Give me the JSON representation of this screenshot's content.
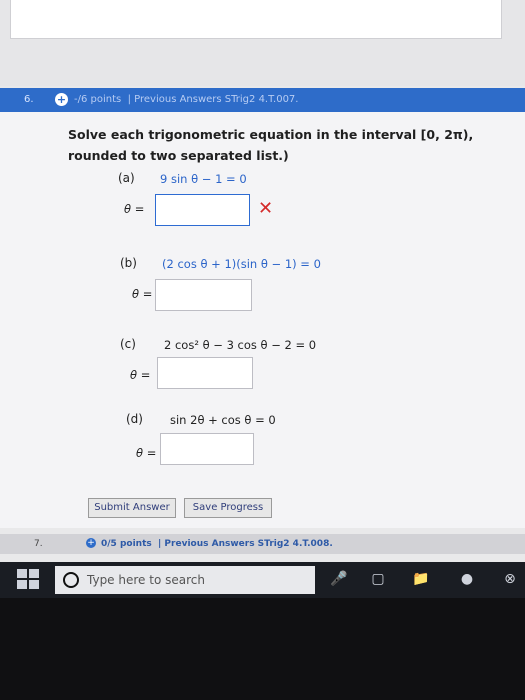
{
  "question6": {
    "number": "6.",
    "points": "-/6 points",
    "source": "| Previous Answers   STrig2 4.T.007."
  },
  "prompt": "Solve each trigonometric equation in the interval [0, 2π), rounded to two separated list.)",
  "parts": [
    {
      "label": "(a)",
      "equation": "9 sin θ − 1 = 0",
      "answer": "",
      "status": "incorrect"
    },
    {
      "label": "(b)",
      "equation": "(2 cos θ + 1)(sin θ − 1) = 0",
      "answer": ""
    },
    {
      "label": "(c)",
      "equation": "2 cos² θ − 3 cos θ − 2 = 0",
      "answer": ""
    },
    {
      "label": "(d)",
      "equation": "sin 2θ + cos θ = 0",
      "answer": ""
    }
  ],
  "theta_label": "θ =",
  "buttons": {
    "submit": "Submit Answer",
    "save": "Save Progress"
  },
  "question7": {
    "number": "7.",
    "points": "0/5 points",
    "source": "|  Previous Answers   STrig2 4.T.008."
  },
  "taskbar": {
    "search_placeholder": "Type here to search"
  },
  "colors": {
    "header_blue": "#2e6cc9",
    "error_red": "#d42a2a"
  },
  "icons": [
    "windows-start-icon",
    "search-ring-icon",
    "microphone-icon",
    "task-view-icon",
    "file-explorer-icon",
    "chrome-icon",
    "xbox-icon"
  ]
}
